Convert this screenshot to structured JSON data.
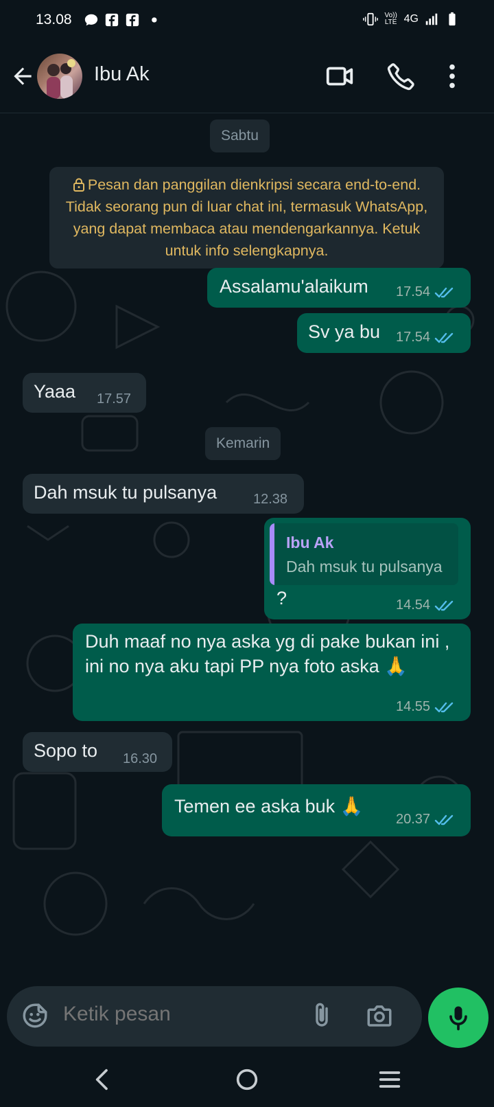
{
  "status_bar": {
    "time": "13.08",
    "network": "4G",
    "volte_label": "Vo)) LTE"
  },
  "header": {
    "contact_name": "Ibu Ak",
    "icons": [
      "back-arrow-icon",
      "avatar",
      "video-call-icon",
      "voice-call-icon",
      "more-options-icon"
    ]
  },
  "chat": {
    "date_chips": {
      "saturday": "Sabtu",
      "yesterday": "Kemarin"
    },
    "encryption_notice": "Pesan dan panggilan dienkripsi secara end-to-end. Tidak seorang pun di luar chat ini, termasuk WhatsApp, yang dapat membaca atau mendengarkannya. Ketuk untuk info selengkapnya.",
    "messages": [
      {
        "direction": "out",
        "text": "Assalamu'alaikum",
        "time": "17.54",
        "status": "read"
      },
      {
        "direction": "out",
        "text": "Sv ya bu",
        "time": "17.54",
        "status": "read"
      },
      {
        "direction": "in",
        "text": "Yaaa",
        "time": "17.57"
      },
      {
        "direction": "in",
        "text": "Dah msuk tu pulsanya",
        "time": "12.38"
      },
      {
        "direction": "out",
        "text": "?",
        "time": "14.54",
        "status": "read",
        "quoted_name": "Ibu Ak",
        "quoted_text": "Dah msuk tu pulsanya"
      },
      {
        "direction": "out",
        "text": "Duh maaf no nya aska yg di pake bukan ini , ini no nya aku tapi PP nya foto aska 🙏",
        "time": "14.55",
        "status": "read"
      },
      {
        "direction": "in",
        "text": "Sopo to",
        "time": "16.30"
      },
      {
        "direction": "out",
        "text": "Temen ee aska buk 🙏",
        "time": "20.37",
        "status": "read"
      }
    ]
  },
  "composer": {
    "placeholder": "Ketik pesan",
    "icons": [
      "sticker-icon",
      "attach-icon",
      "camera-icon",
      "mic-icon"
    ]
  },
  "colors": {
    "background": "#0b141a",
    "outgoing_bubble": "#005c4b",
    "incoming_bubble": "#202c33",
    "accent_green": "#21c063",
    "read_ticks": "#53bdeb",
    "notice_text": "#e0b860"
  }
}
